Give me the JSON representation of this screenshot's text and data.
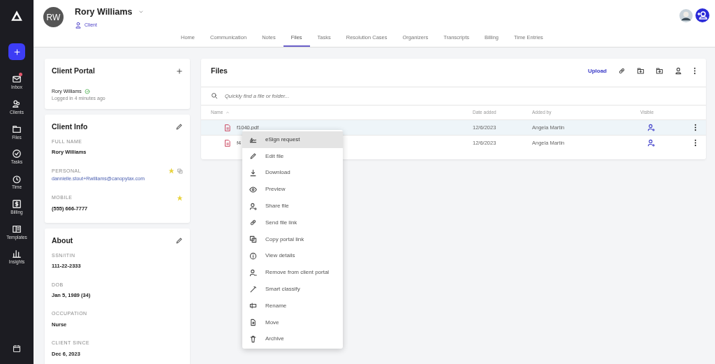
{
  "sidebar": {
    "items": [
      {
        "label": "Inbox",
        "selected": false,
        "badge": true
      },
      {
        "label": "Clients",
        "selected": false,
        "badge": false
      },
      {
        "label": "Files",
        "selected": false,
        "badge": false
      },
      {
        "label": "Tasks",
        "selected": false,
        "badge": false
      },
      {
        "label": "Time",
        "selected": false,
        "badge": false
      },
      {
        "label": "Billing",
        "selected": false,
        "badge": false
      },
      {
        "label": "Templates",
        "selected": false,
        "badge": false
      },
      {
        "label": "Insights",
        "selected": false,
        "badge": false
      }
    ]
  },
  "header": {
    "initials": "RW",
    "name": "Rory Williams",
    "role": "Client"
  },
  "tabs": [
    {
      "label": "Home",
      "selected": false
    },
    {
      "label": "Communication",
      "selected": false
    },
    {
      "label": "Notes",
      "selected": false
    },
    {
      "label": "Files",
      "selected": true
    },
    {
      "label": "Tasks",
      "selected": false
    },
    {
      "label": "Resolution Cases",
      "selected": false
    },
    {
      "label": "Organizers",
      "selected": false
    },
    {
      "label": "Transcripts",
      "selected": false
    },
    {
      "label": "Billing",
      "selected": false
    },
    {
      "label": "Time Entries",
      "selected": false
    }
  ],
  "client_portal": {
    "title": "Client Portal",
    "user": "Rory Williams",
    "status": "Logged in 4 minutes ago"
  },
  "client_info": {
    "title": "Client Info",
    "fields": [
      {
        "label": "FULL NAME",
        "value": "Rory Williams",
        "kind": "text",
        "starred": false
      },
      {
        "label": "PERSONAL",
        "value": "dannielle.stout+Rwilliams@canopytax.com",
        "kind": "email",
        "starred": true
      },
      {
        "label": "MOBILE",
        "value": "(555) 666-7777",
        "kind": "text",
        "starred": true
      }
    ]
  },
  "about": {
    "title": "About",
    "fields": [
      {
        "label": "SSN/ITIN",
        "value": "111-22-2333"
      },
      {
        "label": "DOB",
        "value": "Jan 5, 1989 (34)"
      },
      {
        "label": "OCCUPATION",
        "value": "Nurse"
      },
      {
        "label": "CLIENT SINCE",
        "value": "Dec 6, 2023"
      }
    ]
  },
  "files": {
    "title": "Files",
    "upload": "Upload",
    "search": {
      "placeholder": "Quickly find a file or folder..."
    },
    "columns": [
      "Name",
      "Date added",
      "Added by",
      "Visible"
    ],
    "rows": [
      {
        "name": "f1040.pdf",
        "date": "12/6/2023",
        "added_by": "Angela Martin",
        "selected": true
      },
      {
        "name": "f4",
        "date": "12/6/2023",
        "added_by": "Angela Martin",
        "selected": false
      }
    ]
  },
  "context_menu": [
    {
      "label": "eSign request",
      "selected": true
    },
    {
      "label": "Edit file",
      "selected": false
    },
    {
      "label": "Download",
      "selected": false
    },
    {
      "label": "Preview",
      "selected": false
    },
    {
      "label": "Share file",
      "selected": false
    },
    {
      "label": "Send file link",
      "selected": false
    },
    {
      "label": "Copy portal link",
      "selected": false
    },
    {
      "label": "View details",
      "selected": false
    },
    {
      "label": "Remove from client portal",
      "selected": false
    },
    {
      "label": "Smart classify",
      "selected": false
    },
    {
      "label": "Rename",
      "selected": false
    },
    {
      "label": "Move",
      "selected": false
    },
    {
      "label": "Archive",
      "selected": false
    }
  ]
}
